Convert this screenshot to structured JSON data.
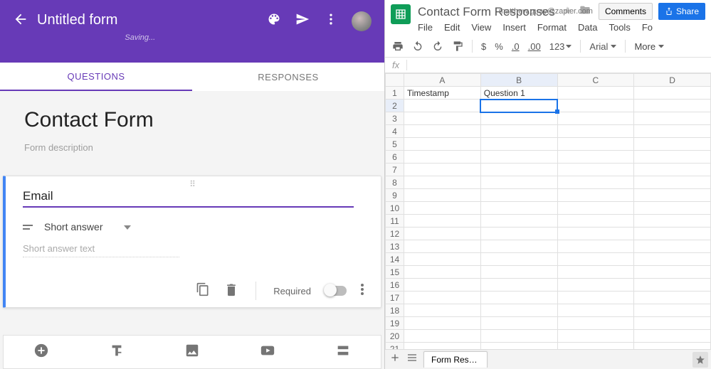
{
  "forms": {
    "header": {
      "title": "Untitled form",
      "status": "Saving..."
    },
    "tabs": {
      "questions": "QUESTIONS",
      "responses": "RESPONSES"
    },
    "form_title": "Contact Form",
    "form_description": "Form description",
    "question": {
      "title_value": "Email",
      "type_label": "Short answer",
      "answer_placeholder": "Short answer text",
      "required_label": "Required",
      "required": false
    }
  },
  "sheets": {
    "title": "Contact Form Responses",
    "user_email": "matthew.guay@zapier.com",
    "menu": [
      "File",
      "Edit",
      "View",
      "Insert",
      "Format",
      "Data",
      "Tools",
      "Fo"
    ],
    "buttons": {
      "comments": "Comments",
      "share": "Share"
    },
    "toolbar": {
      "currency": "$",
      "percent": "%",
      "dec_dec": ".0",
      "dec_inc": ".00",
      "numfmt": "123",
      "font": "Arial",
      "more": "More"
    },
    "formula_bar": {
      "fx": "fx",
      "value": ""
    },
    "columns": [
      "A",
      "B",
      "C",
      "D"
    ],
    "rows": 22,
    "data": {
      "A1": "Timestamp",
      "B1": "Question 1"
    },
    "selected_cell": "B2",
    "sheet_tab": "Form Respons"
  }
}
